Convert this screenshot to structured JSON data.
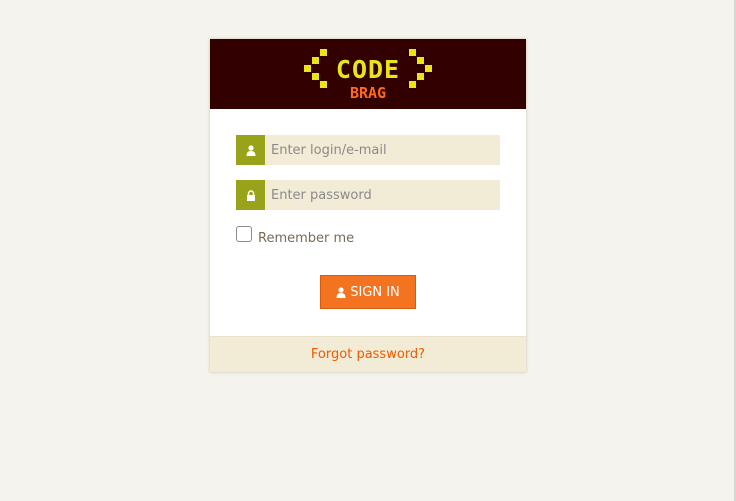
{
  "logo": {
    "main": "CODE",
    "sub": "BRAG",
    "main_color": "#e6e619",
    "sub_color": "#ff6a1a"
  },
  "login": {
    "placeholder": "Enter login/e-mail",
    "value": "",
    "icon": "user-icon"
  },
  "password": {
    "placeholder": "Enter password",
    "value": "",
    "icon": "lock-icon"
  },
  "remember": {
    "label": "Remember me",
    "checked": false
  },
  "signin": {
    "label": "SIGN IN",
    "icon": "user-icon"
  },
  "forgot": {
    "label": "Forgot password?"
  },
  "colors": {
    "header_bg": "#330000",
    "addon_green": "#99a31a",
    "input_bg": "#f2ebd6",
    "button_orange": "#f47321",
    "link_orange": "#f05a00",
    "page_bg": "#f5f3ee"
  }
}
